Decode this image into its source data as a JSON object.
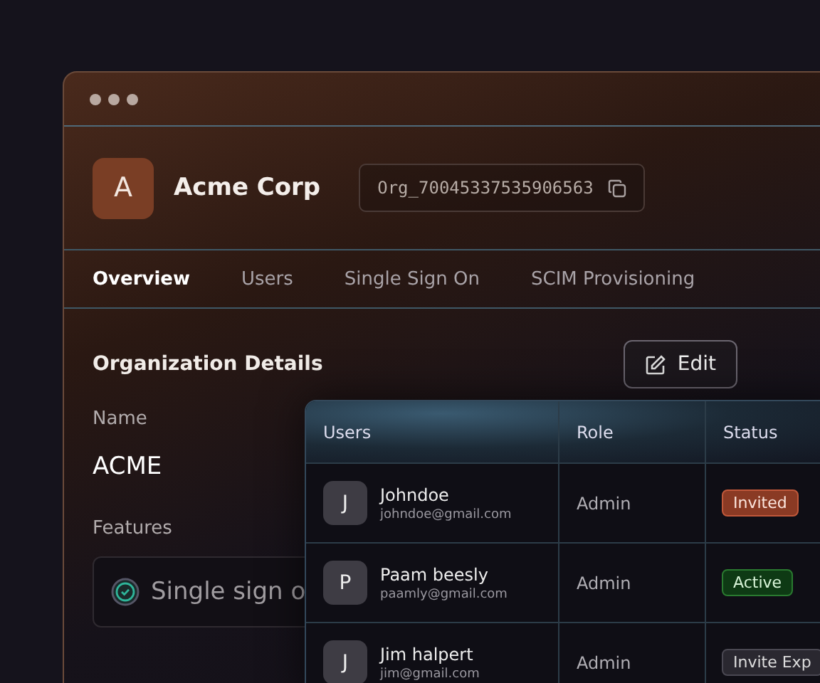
{
  "org": {
    "avatar_letter": "A",
    "name": "Acme Corp",
    "id": "Org_70045337535906563"
  },
  "tabs": [
    {
      "label": "Overview",
      "selected": true
    },
    {
      "label": "Users",
      "selected": false
    },
    {
      "label": "Single Sign On",
      "selected": false
    },
    {
      "label": "SCIM Provisioning",
      "selected": false
    }
  ],
  "details": {
    "title": "Organization Details",
    "edit_button": "Edit",
    "name_label": "Name",
    "name_value": "ACME",
    "features_label": "Features",
    "features": [
      {
        "label": "Single sign o",
        "checked": true
      }
    ]
  },
  "users_table": {
    "columns": [
      "Users",
      "Role",
      "Status"
    ],
    "rows": [
      {
        "initial": "J",
        "name": "Johndoe",
        "email": "johndoe@gmail.com",
        "role": "Admin",
        "status": "Invited",
        "kind": "invited"
      },
      {
        "initial": "P",
        "name": "Paam beesly",
        "email": "paamly@gmail.com",
        "role": "Admin",
        "status": "Active",
        "kind": "active"
      },
      {
        "initial": "J",
        "name": "Jim halpert",
        "email": "jim@gmail.com",
        "role": "Admin",
        "status": "Invite Exp",
        "kind": "expired"
      }
    ]
  }
}
